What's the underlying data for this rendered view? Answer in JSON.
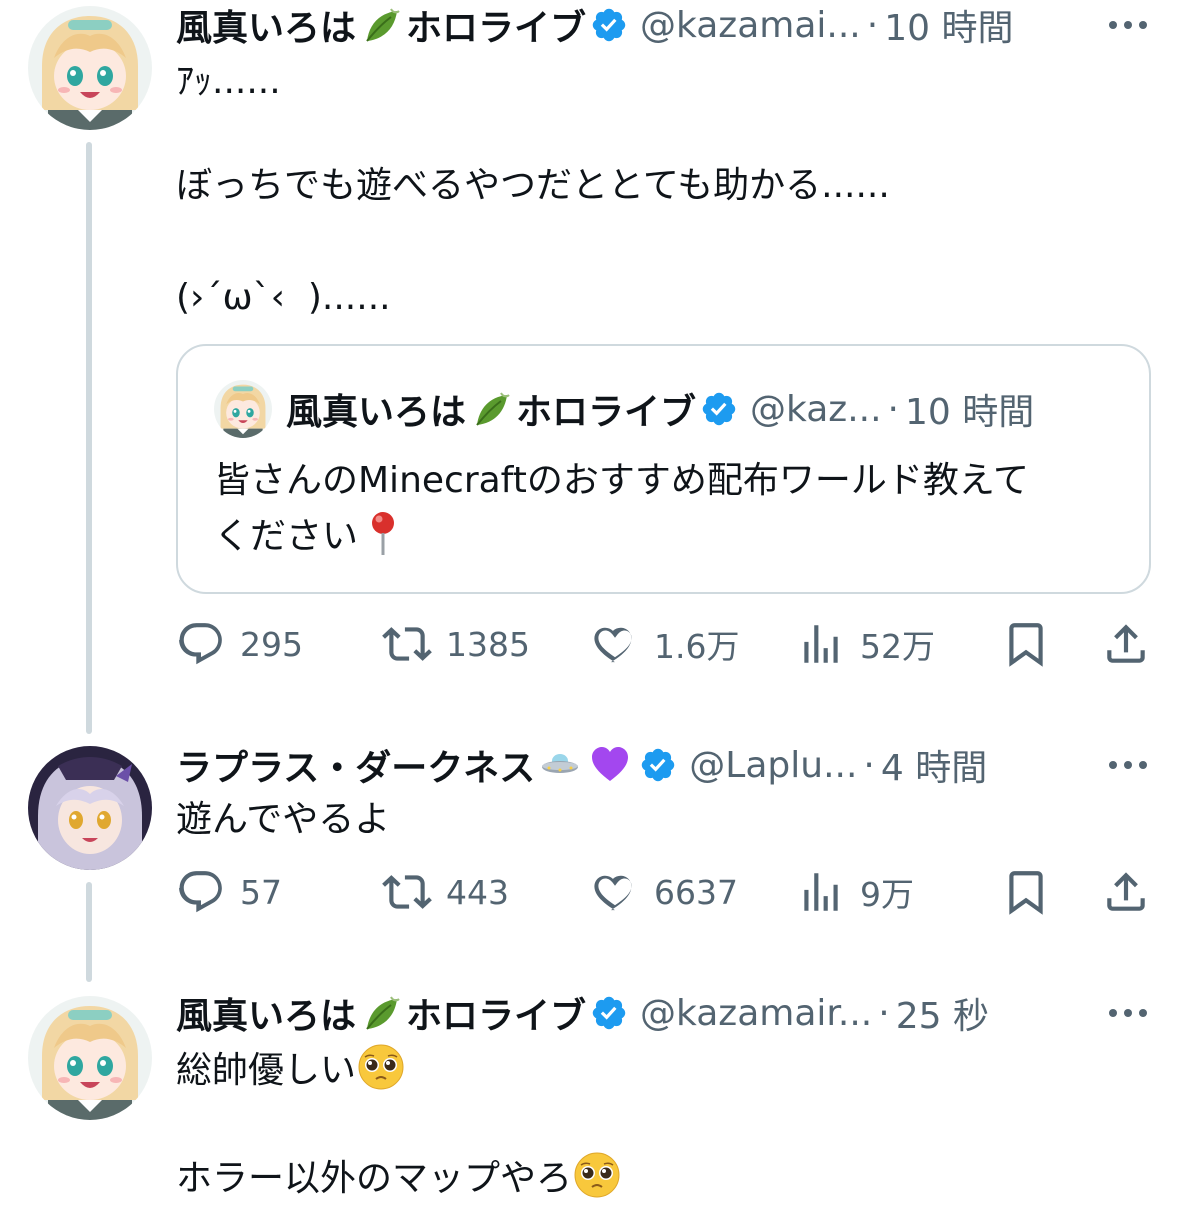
{
  "posts": [
    {
      "name": "風真いろは",
      "name_suffix": "ホロライブ",
      "name_emoji": "leaf",
      "handle": "@kazamai...",
      "time": "10 時間",
      "text_lines": [
        "ｱｯ......",
        "",
        "ぼっちでも遊べるやつだととても助かる......",
        "",
        "(›´ω`‹  )......"
      ],
      "quote": {
        "name": "風真いろは",
        "name_suffix": "ホロライブ",
        "handle": "@kaz...",
        "time": "10 時間",
        "text_line1": "皆さんのMinecraftのおすすめ配布ワールド教えて",
        "text_line2": "ください"
      },
      "stats": {
        "replies": "295",
        "reposts": "1385",
        "likes": "1.6万",
        "views": "52万"
      }
    },
    {
      "name": "ラプラス・ダークネス",
      "name_emojis": [
        "ufo",
        "purple-heart"
      ],
      "handle": "@Laplu...",
      "time": "4 時間",
      "text": "遊んでやるよ",
      "stats": {
        "replies": "57",
        "reposts": "443",
        "likes": "6637",
        "views": "9万"
      }
    },
    {
      "name": "風真いろは",
      "name_suffix": "ホロライブ",
      "name_emoji": "leaf",
      "handle": "@kazamair...",
      "time": "25 秒",
      "text_line1": "総帥優しい",
      "text_line2": "",
      "text_line3": "ホラー以外のマップやろ"
    }
  ],
  "separator": "·",
  "colors": {
    "text": "#0f1419",
    "secondary": "#536471",
    "verified": "#1d9bf0",
    "border": "#cfd9de"
  },
  "icons": [
    "more-icon",
    "verified-badge-icon",
    "reply-icon",
    "repost-icon",
    "like-icon",
    "views-icon",
    "bookmark-icon",
    "share-icon",
    "leaf-emoji",
    "ufo-emoji",
    "purple-heart-emoji",
    "pushpin-emoji",
    "pleading-face-emoji"
  ]
}
